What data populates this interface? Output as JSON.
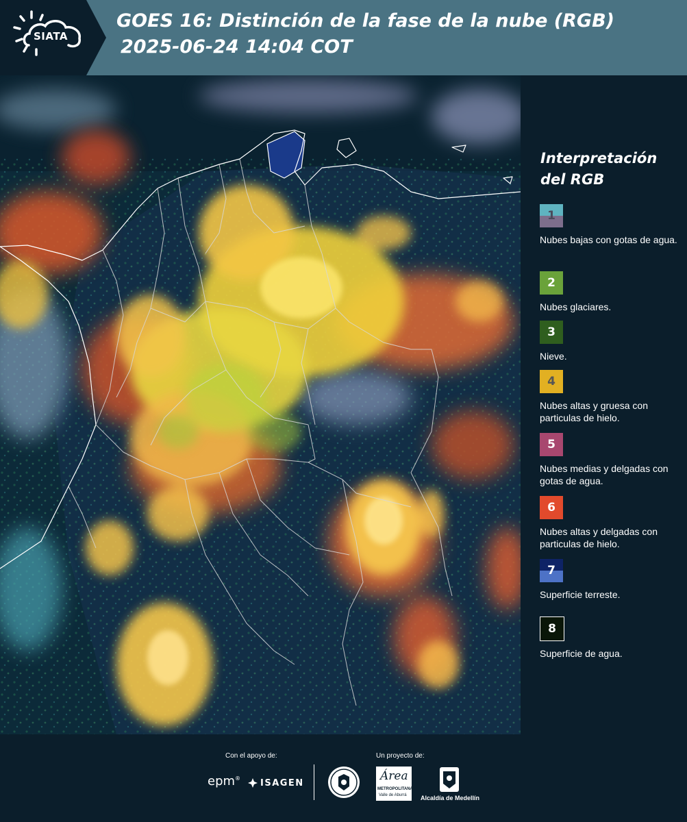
{
  "header": {
    "logo_text": "SIATA",
    "title_line1": "GOES 16: Distinción de la fase de la nube (RGB)",
    "title_line2": "2025-06-24 14:04 COT",
    "background_color": "#4a7383"
  },
  "map": {
    "description_icon": "satellite-rgb-map",
    "ocean_color": "#0c2a39",
    "boundary_color": "#ffffff"
  },
  "legend": {
    "title": "Interpretación del RGB",
    "items": [
      {
        "number": "1",
        "label": "Nubes bajas con gotas de agua.",
        "color_top": "#5fb3c0",
        "color_bottom": "#7d6e8c",
        "text_color": "#4a4a5a"
      },
      {
        "number": "2",
        "label": "Nubes glaciares.",
        "color_top": "#6aa23a",
        "color_bottom": "#6aa23a",
        "text_color": "#ffffff"
      },
      {
        "number": "3",
        "label": "Nieve.",
        "color_top": "#2f5e1e",
        "color_bottom": "#2f5e1e",
        "text_color": "#ffffff"
      },
      {
        "number": "4",
        "label": "Nubes altas y gruesa con particulas de hielo.",
        "color_top": "#e2b022",
        "color_bottom": "#e2b022",
        "text_color": "#555555"
      },
      {
        "number": "5",
        "label": "Nubes medias y delgadas con gotas de agua.",
        "color_top": "#a8476f",
        "color_bottom": "#a8476f",
        "text_color": "#ffffff"
      },
      {
        "number": "6",
        "label": "Nubes altas y delgadas con particulas de hielo.",
        "color_top": "#e24a2c",
        "color_bottom": "#e24a2c",
        "text_color": "#ffffff"
      },
      {
        "number": "7",
        "label": "Superficie terreste.",
        "color_top": "#0e2366",
        "color_bottom": "#4d72c6",
        "text_color": "#ffffff"
      },
      {
        "number": "8",
        "label": "Superficie de agua.",
        "color_top": "#0a1608",
        "color_bottom": "#0a1608",
        "text_color": "#ffffff"
      }
    ]
  },
  "footer": {
    "support_label": "Con el apoyo de:",
    "project_label": "Un proyecto de:",
    "epm": "epm",
    "isagen": "ISAGEN",
    "area_line1": "Área",
    "area_line2": "METROPOLITANA",
    "area_line3": "Valle de Aburrá",
    "alcaldia": "Alcaldía de Medellín"
  }
}
